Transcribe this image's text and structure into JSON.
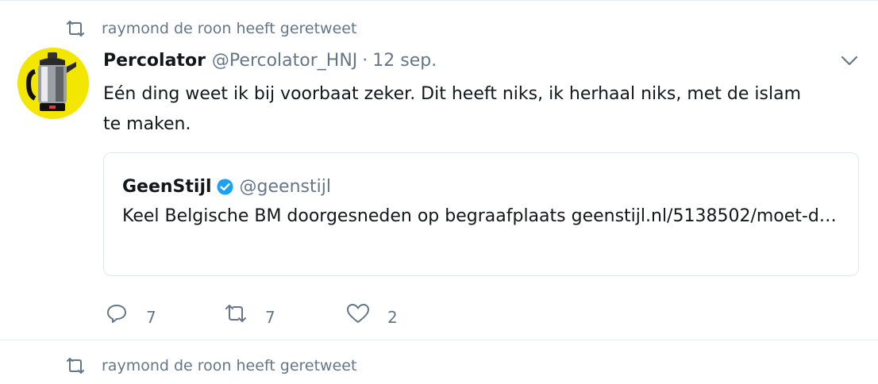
{
  "retweet_context_top": {
    "text": "raymond de roon heeft geretweet"
  },
  "tweet": {
    "author_name": "Percolator",
    "handle": "@Percolator_HNJ",
    "separator": "·",
    "timestamp": "12 sep.",
    "text": "Eén ding weet ik bij voorbaat zeker. Dit heeft niks, ik herhaal niks, met de islam te maken.",
    "quote": {
      "name": "GeenStijl",
      "handle": "@geenstijl",
      "text": "Keel Belgische BM doorgesneden op begraafplaats geenstijl.nl/5138502/moet-d…"
    },
    "actions": {
      "reply_count": "7",
      "retweet_count": "7",
      "like_count": "2"
    }
  },
  "retweet_context_bottom": {
    "text": "raymond de roon heeft geretweet"
  },
  "colors": {
    "muted": "#657786",
    "text": "#14171a",
    "verified": "#1da1f2",
    "avatar_bg": "#f3e600"
  },
  "icons": [
    "retweet-icon",
    "chevron-down-icon",
    "verified-badge-icon",
    "reply-icon",
    "heart-icon"
  ]
}
